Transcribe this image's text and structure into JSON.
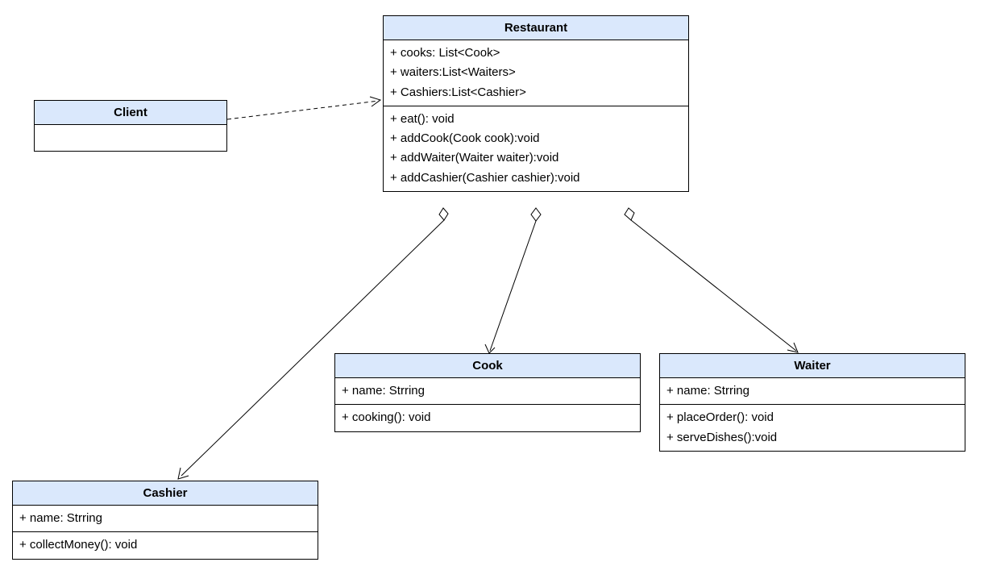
{
  "classes": {
    "client": {
      "name": "Client",
      "attributes": [],
      "methods": []
    },
    "restaurant": {
      "name": "Restaurant",
      "attributes": [
        "+ cooks: List<Cook>",
        "+ waiters:List<Waiters>",
        "+ Cashiers:List<Cashier>"
      ],
      "methods": [
        "+ eat(): void",
        "+ addCook(Cook cook):void",
        "+ addWaiter(Waiter waiter):void",
        "+ addCashier(Cashier cashier):void"
      ]
    },
    "cook": {
      "name": "Cook",
      "attributes": [
        "+ name: Strring"
      ],
      "methods": [
        "+ cooking(): void"
      ]
    },
    "waiter": {
      "name": "Waiter",
      "attributes": [
        "+ name: Strring"
      ],
      "methods": [
        "+ placeOrder(): void",
        "+ serveDishes():void"
      ]
    },
    "cashier": {
      "name": "Cashier",
      "attributes": [
        "+ name: Strring"
      ],
      "methods": [
        "+ collectMoney(): void"
      ]
    }
  },
  "relationships": [
    {
      "from": "Client",
      "to": "Restaurant",
      "type": "dependency"
    },
    {
      "from": "Restaurant",
      "to": "Cashier",
      "type": "aggregation"
    },
    {
      "from": "Restaurant",
      "to": "Cook",
      "type": "aggregation"
    },
    {
      "from": "Restaurant",
      "to": "Waiter",
      "type": "aggregation"
    }
  ]
}
